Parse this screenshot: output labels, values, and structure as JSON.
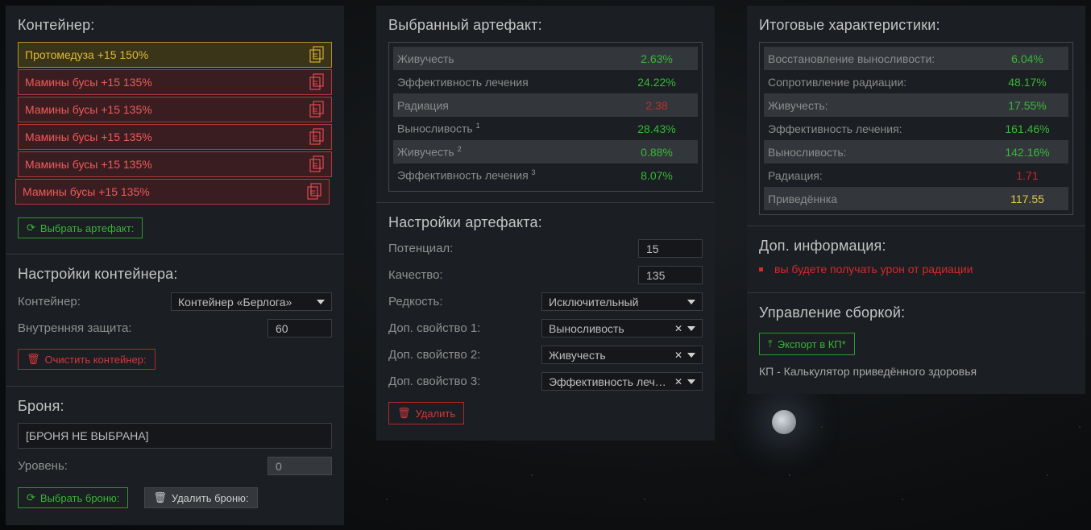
{
  "container_panel": {
    "title": "Контейнер:",
    "slots": [
      {
        "label": "Протомедуза +15 150%",
        "state": "gold"
      },
      {
        "label": "Мамины бусы +15 135%",
        "state": "red"
      },
      {
        "label": "Мамины бусы +15 135%",
        "state": "red"
      },
      {
        "label": "Мамины бусы +15 135%",
        "state": "red"
      },
      {
        "label": "Мамины бусы +15 135%",
        "state": "red"
      },
      {
        "label": "Мамины бусы +15 135%",
        "state": "red"
      }
    ],
    "select_artifact_label": "Выбрать артефакт:",
    "settings_title": "Настройки контейнера:",
    "container_label": "Контейнер:",
    "container_value": "Контейнер «Берлога»",
    "inner_protection_label": "Внутренняя защита:",
    "inner_protection_value": "60",
    "clear_label": "Очистить контейнер:",
    "armor_title": "Броня:",
    "armor_value": "[БРОНЯ НЕ ВЫБРАНА]",
    "level_label": "Уровень:",
    "level_value": "0",
    "select_armor_label": "Выбрать броню:",
    "delete_armor_label": "Удалить броню:"
  },
  "artifact_panel": {
    "title": "Выбранный артефакт:",
    "stats": [
      {
        "label": "Живучесть",
        "sup": "",
        "value": "2.63%",
        "color": "green"
      },
      {
        "label": "Эффективность лечения",
        "sup": "",
        "value": "24.22%",
        "color": "green"
      },
      {
        "label": "Радиация",
        "sup": "",
        "value": "2.38",
        "color": "red"
      },
      {
        "label": "Выносливость",
        "sup": "1",
        "value": "28.43%",
        "color": "green"
      },
      {
        "label": "Живучесть",
        "sup": "2",
        "value": "0.88%",
        "color": "green"
      },
      {
        "label": "Эффективность лечения",
        "sup": "3",
        "value": "8.07%",
        "color": "green"
      }
    ],
    "settings_title": "Настройки артефакта:",
    "potential_label": "Потенциал:",
    "potential_value": "15",
    "quality_label": "Качество:",
    "quality_value": "135",
    "rarity_label": "Редкость:",
    "rarity_value": "Исключительный",
    "extra1_label": "Доп. свойство 1:",
    "extra1_value": "Выносливость",
    "extra2_label": "Доп. свойство 2:",
    "extra2_value": "Живучесть",
    "extra3_label": "Доп. свойство 3:",
    "extra3_value": "Эффективность лечения",
    "delete_label": "Удалить"
  },
  "results_panel": {
    "title": "Итоговые характеристики:",
    "stats": [
      {
        "label": "Восстановление выносливости:",
        "value": "6.04%",
        "color": "green"
      },
      {
        "label": "Сопротивление радиации:",
        "value": "48.17%",
        "color": "green"
      },
      {
        "label": "Живучесть:",
        "value": "17.55%",
        "color": "green"
      },
      {
        "label": "Эффективность лечения:",
        "value": "161.46%",
        "color": "green"
      },
      {
        "label": "Выносливость:",
        "value": "142.16%",
        "color": "green"
      },
      {
        "label": "Радиация:",
        "value": "1.71",
        "color": "red"
      },
      {
        "label": "Приведённка",
        "value": "117.55",
        "color": "yellow"
      }
    ],
    "info_title": "Доп. информация:",
    "warning": "вы будете получать урон от радиации",
    "build_title": "Управление сборкой:",
    "export_label": "Экспорт в КП*",
    "footnote": "КП - Калькулятор приведённого здоровья"
  },
  "colors": {
    "green": "#37b837",
    "red": "#c42a2a",
    "yellow": "#e3c64a",
    "gold_border": "#b49322",
    "red_border": "#b03a40"
  }
}
